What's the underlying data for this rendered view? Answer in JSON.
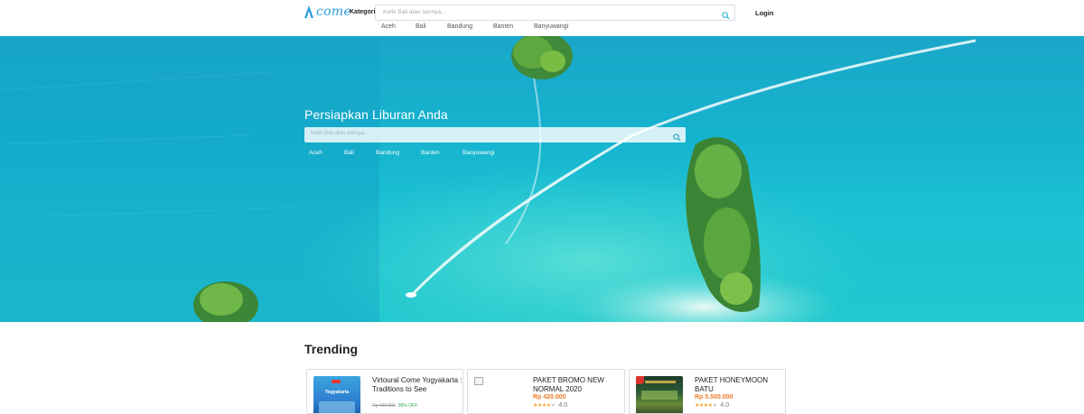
{
  "header": {
    "logo_text": "come",
    "category_label": "Kategori",
    "search_placeholder": "Ketik Bali atau lainnya...",
    "quick_links": [
      "Aceh",
      "Bali",
      "Bandung",
      "Banten",
      "Banyuwangi"
    ],
    "login_label": "Login"
  },
  "hero": {
    "title": "Persiapkan Liburan Anda",
    "search_placeholder": "Ketik Bali atau lainnya...",
    "quick_links": [
      "Aceh",
      "Bali",
      "Bandung",
      "Banten",
      "Banyuwangi"
    ]
  },
  "trending": {
    "title": "Trending",
    "cards": [
      {
        "title": "Virtoural Come Yogyakarta : Traditions to See",
        "old_price": "Rp 400.000",
        "discount": "90% OFF",
        "thumb_text": "Yogyakarta"
      },
      {
        "title": "PAKET BROMO NEW NORMAL 2020",
        "price": "Rp 420.000",
        "rating": "4.0",
        "stars": 4
      },
      {
        "title": "PAKET HONEYMOON BATU",
        "price": "Rp 5.500.000",
        "rating": "4.0",
        "stars": 4
      }
    ]
  },
  "colors": {
    "brand": "#2a9bd8",
    "price": "#f07a28",
    "star": "#f5a623",
    "sea": "#18b4cf"
  }
}
